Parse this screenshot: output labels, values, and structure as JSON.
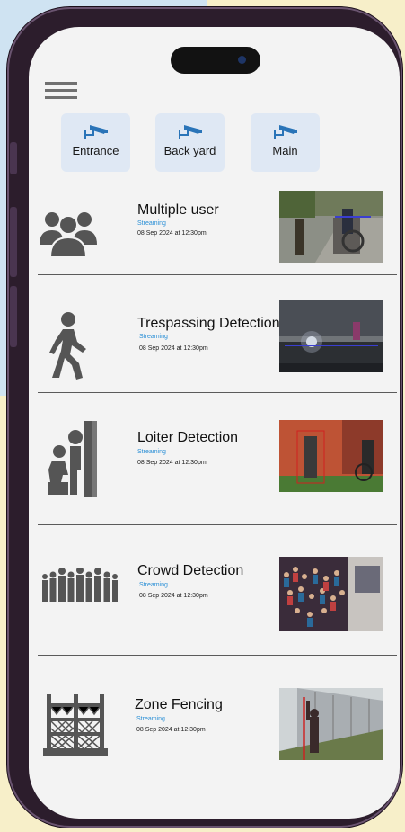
{
  "colors": {
    "accent": "#2a8fd6",
    "icon": "#555555",
    "camera": "#2a74b8",
    "tab_bg": "#dfe8f4"
  },
  "cameras": [
    {
      "label": "Entrance",
      "icon": "cctv-camera-icon"
    },
    {
      "label": "Back yard",
      "icon": "cctv-camera-icon"
    },
    {
      "label": "Main",
      "icon": "cctv-camera-icon"
    }
  ],
  "detections": [
    {
      "title": "Multiple user",
      "status": "Streaming",
      "time": "08 Sep 2024 at 12:30pm",
      "icon": "group-users-icon"
    },
    {
      "title": "Trespassing Detection",
      "status": "Streaming",
      "time": "08 Sep 2024 at 12:30pm",
      "icon": "walking-person-icon"
    },
    {
      "title": "Loiter Detection",
      "status": "Streaming",
      "time": "08 Sep 2024 at 12:30pm",
      "icon": "loitering-person-icon"
    },
    {
      "title": "Crowd Detection",
      "status": "Streaming",
      "time": "08 Sep 2024 at 12:30pm",
      "icon": "crowd-icon"
    },
    {
      "title": "Zone Fencing",
      "status": "Streaming",
      "time": "08 Sep 2024 at 12:30pm",
      "icon": "fence-icon"
    }
  ]
}
